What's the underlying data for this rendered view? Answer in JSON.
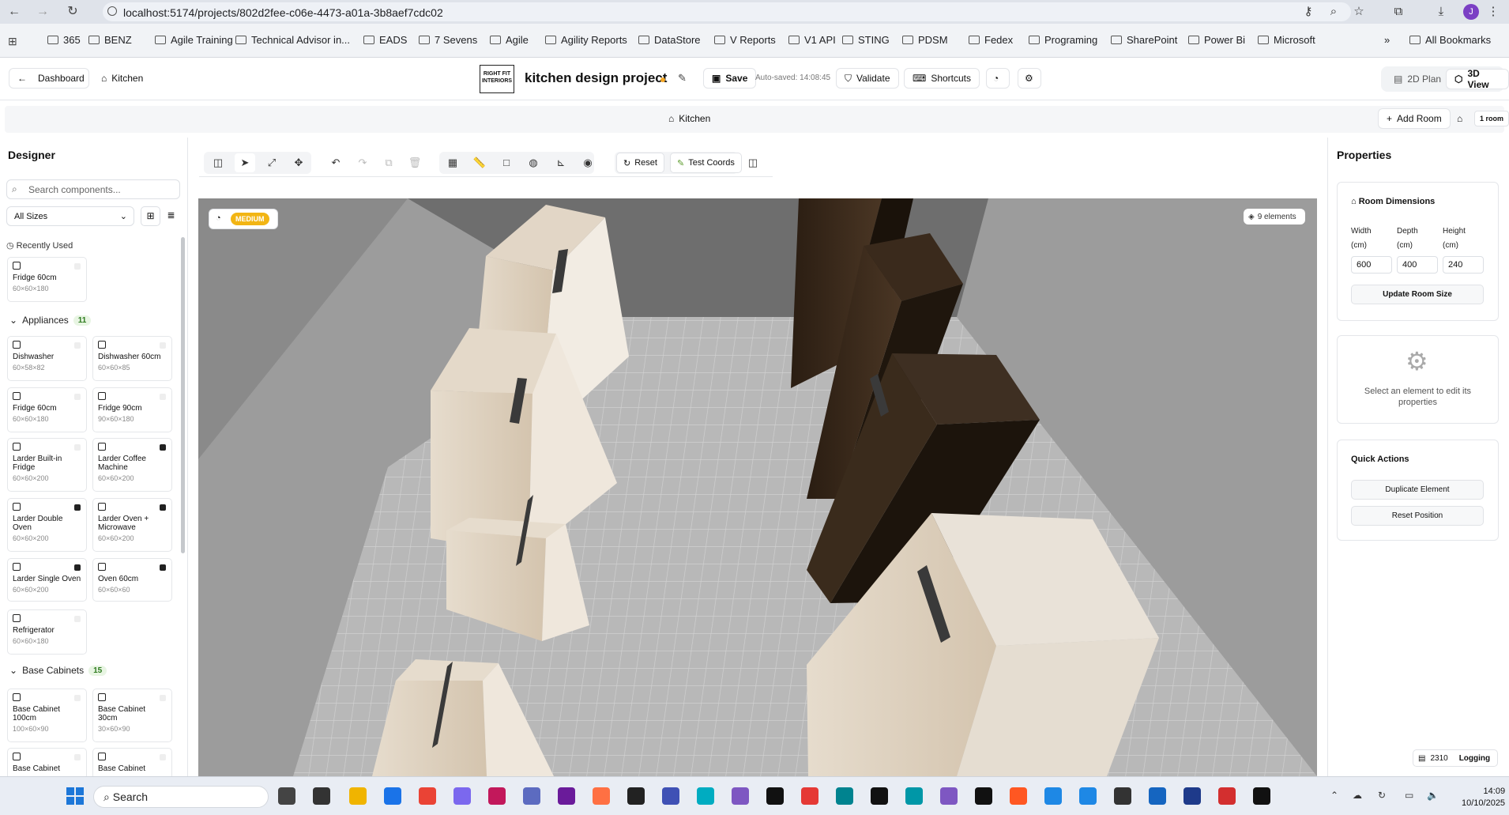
{
  "browser": {
    "url": "localhost:5174/projects/802d2fee-c06e-4473-a01a-3b8aef7cdc02",
    "profile_initial": "J",
    "bookmarks": [
      "365",
      "BENZ",
      "Agile Training",
      "Technical Advisor in...",
      "EADS",
      "7 Sevens",
      "Agile",
      "Agility Reports",
      "DataStore",
      "V Reports",
      "V1 API",
      "STING",
      "PDSM",
      "Fedex",
      "Programing",
      "SharePoint",
      "Power Bi",
      "Microsoft"
    ],
    "all_bookmarks": "All Bookmarks",
    "overflow": "»"
  },
  "header": {
    "dashboard": "Dashboard",
    "breadcrumb": "Kitchen",
    "logo_text": "RIGHT FIT INTERIORS",
    "title": "kitchen design project",
    "save": "Save",
    "autosaved": "Auto-saved: 14:08:45",
    "validate": "Validate",
    "shortcuts": "Shortcuts",
    "view_2d": "2D Plan",
    "view_3d": "3D View"
  },
  "room_bar": {
    "room_tab": "Kitchen",
    "add_room": "Add Room",
    "room_count": "1 room"
  },
  "sidebar": {
    "title": "Designer",
    "search_placeholder": "Search components...",
    "size_filter": "All Sizes",
    "recently_used_label": "Recently Used",
    "recently_used": [
      {
        "name": "Fridge 60cm",
        "dims": "60×60×180"
      }
    ],
    "categories": [
      {
        "name": "Appliances",
        "count": "11",
        "items": [
          {
            "name": "Dishwasher",
            "dims": "60×58×82"
          },
          {
            "name": "Dishwasher 60cm",
            "dims": "60×60×85"
          },
          {
            "name": "Fridge 60cm",
            "dims": "60×60×180"
          },
          {
            "name": "Fridge 90cm",
            "dims": "90×60×180"
          },
          {
            "name": "Larder Built-in Fridge",
            "dims": "60×60×200"
          },
          {
            "name": "Larder Coffee Machine",
            "dims": "60×60×200"
          },
          {
            "name": "Larder Double Oven",
            "dims": "60×60×200"
          },
          {
            "name": "Larder Oven + Microwave",
            "dims": "60×60×200"
          },
          {
            "name": "Larder Single Oven",
            "dims": "60×60×200"
          },
          {
            "name": "Oven 60cm",
            "dims": "60×60×60"
          },
          {
            "name": "Refrigerator",
            "dims": "60×60×180"
          }
        ]
      },
      {
        "name": "Base Cabinets",
        "count": "15",
        "items": [
          {
            "name": "Base Cabinet 100cm",
            "dims": "100×60×90"
          },
          {
            "name": "Base Cabinet 30cm",
            "dims": "30×60×90"
          },
          {
            "name": "Base Cabinet",
            "dims": ""
          },
          {
            "name": "Base Cabinet",
            "dims": ""
          }
        ]
      }
    ]
  },
  "toolbar": {
    "reset": "Reset",
    "test_coords": "Test Coords"
  },
  "canvas": {
    "quality": "MEDIUM",
    "elements": "9 elements"
  },
  "properties": {
    "title": "Properties",
    "room_dims_title": "Room Dimensions",
    "width_label": "Width",
    "depth_label": "Depth",
    "height_label": "Height",
    "unit": "(cm)",
    "width": "600",
    "depth": "400",
    "height": "240",
    "update_button": "Update Room Size",
    "empty_hint": "Select an element to edit its properties",
    "quick_actions": "Quick Actions",
    "duplicate": "Duplicate Element",
    "reset_position": "Reset Position",
    "log_count": "2310",
    "logging": "Logging"
  },
  "taskbar": {
    "search": "Search",
    "time": "14:09",
    "date": "10/10/2025"
  }
}
